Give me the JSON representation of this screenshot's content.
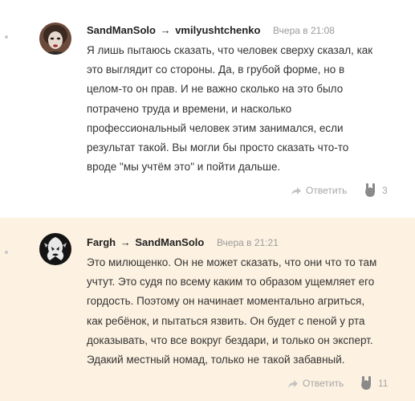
{
  "comments": [
    {
      "author": "SandManSolo",
      "arrow": "→",
      "target": "vmilyushtchenko",
      "time": "Вчера в 21:08",
      "avatar_icon": "user-avatar-photo",
      "lines": [
        "Я лишь пытаюсь сказать, что человек сверху сказал, как",
        "это выглядит со стороны. Да, в грубой форме, но в",
        "целом-то он прав. И не важно сколько на это было",
        "потрачено труда и времени, и насколько",
        "профессиональный человек этим занимался, если",
        "результат такой. Вы могли бы просто сказать что-то",
        "вроде \"мы учтём это\" и пойти дальше."
      ],
      "reply_label": "Ответить",
      "like_count": "3"
    },
    {
      "author": "Fargh",
      "arrow": "→",
      "target": "SandManSolo",
      "time": "Вчера в 21:21",
      "avatar_icon": "user-avatar-emblem",
      "lines": [
        "Это милющенко. Он не может сказать, что они что то там",
        "учтут. Это судя по всему каким то образом ущемляет его",
        "гордость. Поэтому он начинает моментально агриться,",
        "как ребёнок, и пытаться язвить. Он будет с пеной у рта",
        "доказывать, что все вокруг бездари, и только он эксперт.",
        "Эдакий местный номад, только не такой забавный."
      ],
      "reply_label": "Ответить",
      "like_count": "11"
    }
  ],
  "colors": {
    "highlight_bg": "#fdf2e1",
    "muted": "#a6a6a6",
    "time": "#9a9a9a"
  },
  "icons": {
    "reply": "reply-arrow-icon",
    "like": "rock-hand-icon"
  }
}
